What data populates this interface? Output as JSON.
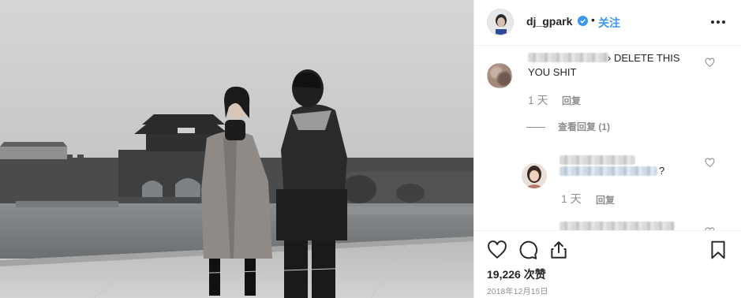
{
  "post": {
    "username": "dj_gpark",
    "dot": "•",
    "follow_label": "关注",
    "likes": "19,226 次赞",
    "date": "2018年12月15日"
  },
  "comments": [
    {
      "text_visible": "› DELETE THIS",
      "text_line2": "YOU SHIT",
      "time": "1 天",
      "reply_label": "回复",
      "view_replies": "查看回复 (1)"
    },
    {
      "text_visible": "?",
      "time": "1 天",
      "reply_label": "回复"
    }
  ],
  "icons": {
    "verified": "verified-badge-icon",
    "more": "more-options-icon",
    "like": "heart-icon",
    "comment": "comment-icon",
    "share": "share-icon",
    "save": "bookmark-icon"
  },
  "colors": {
    "accent": "#3897f0",
    "text": "#262626",
    "muted": "#8e8e8e",
    "border": "#efefef"
  }
}
